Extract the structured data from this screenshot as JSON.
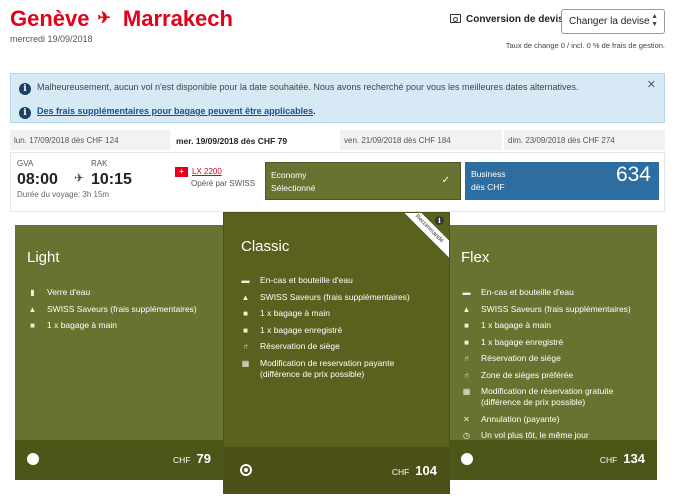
{
  "header": {
    "origin": "Genève",
    "destination": "Marrakech",
    "date": "mercredi 19/09/2018",
    "currency_label": "Conversion de devise",
    "currency_button": "Changer la devise",
    "rate_text": "Taux de change 0 / incl. 0 % de frais de gestion."
  },
  "alert": {
    "message": "Malheureusement, aucun vol n'est disponible pour la date souhaitée. Nous avons recherché pour vous les meilleures dates alternatives.",
    "link": "Des frais supplémentaires pour bagage peuvent être applicables",
    "link_suffix": "."
  },
  "dates": [
    "lun. 17/09/2018 dès CHF 124",
    "mer. 19/09/2018 dès CHF 79",
    "ven. 21/09/2018 dès CHF 184",
    "dim. 23/09/2018 dès CHF 274"
  ],
  "flight": {
    "origin_code": "GVA",
    "destination_code": "RAK",
    "departure": "08:00",
    "arrival": "10:15",
    "duration": "Durée du voyage: 3h 15m",
    "flight_number": "LX 2200",
    "operator": "Opéré par SWISS",
    "economy_label": "Economy",
    "economy_status": "Sélectionné",
    "business_label": "Business",
    "business_from": "dès CHF",
    "business_price": "634"
  },
  "fares": {
    "light": {
      "name": "Light",
      "features": [
        "Verre d'eau",
        "SWISS Saveurs (frais supplémentaires)",
        "1 x bagage à main"
      ],
      "currency": "CHF",
      "price": "79"
    },
    "classic": {
      "name": "Classic",
      "ribbon": "Recommandé",
      "features": [
        "En-cas et bouteille d'eau",
        "SWISS Saveurs (frais supplémentaires)",
        "1 x bagage à main",
        "1 x bagage enregistré",
        "Réservation de siège",
        "Modification de reservation payante",
        "(différence de prix possible)"
      ],
      "currency": "CHF",
      "price": "104"
    },
    "flex": {
      "name": "Flex",
      "features": [
        "En-cas et bouteille d'eau",
        "SWISS Saveurs (frais supplémentaires)",
        "1 x bagage à main",
        "1 x bagage enregistré",
        "Réservation de siège",
        "Zone de sièges préférée",
        "Modification de réservation gratuite",
        "(différence de prix possible)",
        "Annulation (payante)",
        "Un vol plus tôt, le même jour"
      ],
      "currency": "CHF",
      "price": "134"
    }
  }
}
